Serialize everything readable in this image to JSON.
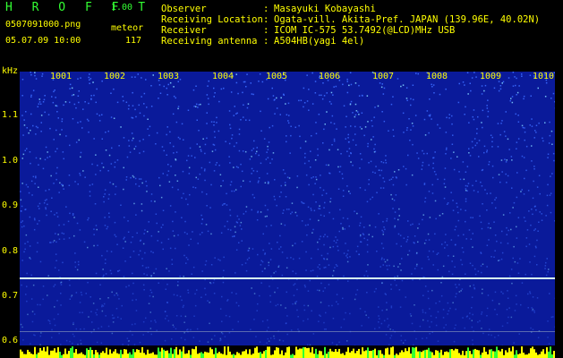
{
  "header": {
    "title": "H R O F F T",
    "version": "1.00",
    "filename": "0507091000.png",
    "meteor_label": "meteor",
    "datetime": "05.07.09 10:00",
    "meteor_count": "117"
  },
  "metadata": [
    {
      "label": "Observer",
      "value": "Masayuki Kobayashi"
    },
    {
      "label": "Receiving Location",
      "value": "Ogata-vill. Akita-Pref. JAPAN (139.96E, 40.02N)"
    },
    {
      "label": "Receiver",
      "value": "ICOM IC-575 53.7492(@LCD)MHz USB"
    },
    {
      "label": "Receiving antenna",
      "value": "A504HB(yagi 4el)"
    }
  ],
  "spectrogram": {
    "y_unit": "kHz",
    "y_ticks": [
      "1.1",
      "1.0",
      "0.9",
      "0.8",
      "0.7",
      "0.6"
    ],
    "x_ticks": [
      "1001",
      "1002",
      "1003",
      "1004",
      "1005",
      "1006",
      "1007",
      "1008",
      "1009",
      "1010"
    ],
    "colors": {
      "background": "#0a1a9a",
      "noise_bright": "#3a6aff",
      "signal_line": "#d8fff0",
      "label": "#ffff00",
      "title": "#33ff33"
    }
  }
}
